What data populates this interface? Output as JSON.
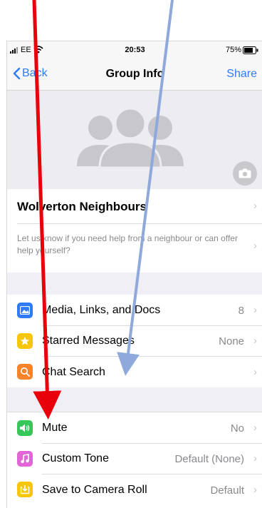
{
  "status_bar": {
    "carrier": "EE",
    "time": "20:53",
    "battery": "75%"
  },
  "nav": {
    "back_label": "Back",
    "title": "Group Info",
    "share_label": "Share"
  },
  "group": {
    "name": "Wolverton Neighbours",
    "description": "Let us know if you need help from a neighbour or can offer help yourself?"
  },
  "media_section": {
    "items": [
      {
        "label": "Media, Links, and Docs",
        "value": "8",
        "icon": "photo-icon",
        "color": "#2f7bf6"
      },
      {
        "label": "Starred Messages",
        "value": "None",
        "icon": "star-icon",
        "color": "#f5c60a"
      },
      {
        "label": "Chat Search",
        "value": "",
        "icon": "search-icon",
        "color": "#f7842a"
      }
    ]
  },
  "settings_section": {
    "items": [
      {
        "label": "Mute",
        "value": "No",
        "icon": "speaker-icon",
        "color": "#35c759"
      },
      {
        "label": "Custom Tone",
        "value": "Default (None)",
        "icon": "music-note-icon",
        "color": "#e264d6"
      },
      {
        "label": "Save to Camera Roll",
        "value": "Default",
        "icon": "download-icon",
        "color": "#f5c60a"
      }
    ]
  },
  "colors": {
    "accent": "#2f7bf6",
    "red_arrow": "#e8000b",
    "blue_arrow": "#8fa9dc"
  }
}
